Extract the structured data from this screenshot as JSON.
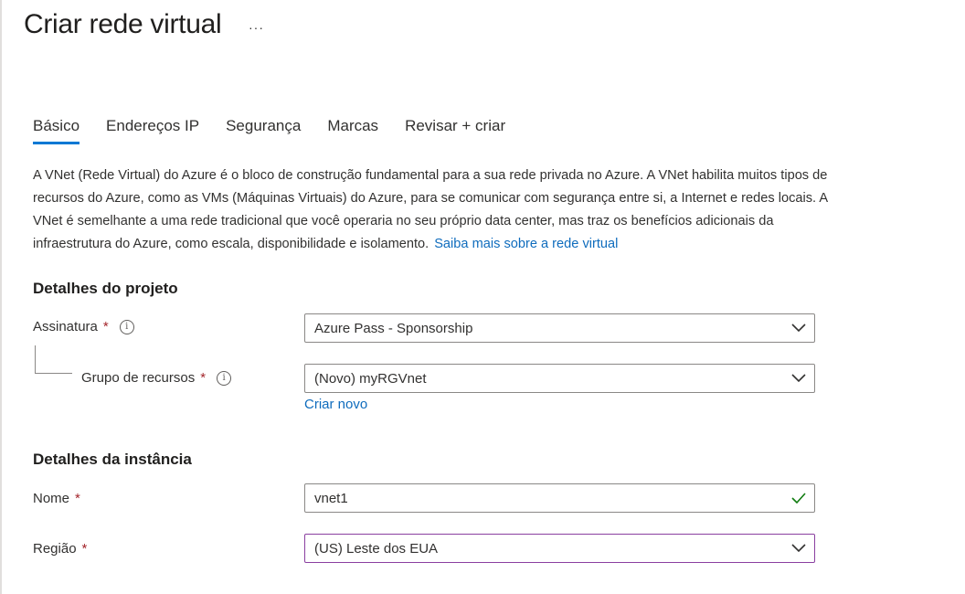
{
  "header": {
    "title": "Criar rede virtual",
    "more_label": "···"
  },
  "tabs": [
    {
      "label": "Básico",
      "active": true
    },
    {
      "label": "Endereços IP",
      "active": false
    },
    {
      "label": "Segurança",
      "active": false
    },
    {
      "label": "Marcas",
      "active": false
    },
    {
      "label": "Revisar + criar",
      "active": false
    }
  ],
  "intro": {
    "text": "A VNet (Rede Virtual) do Azure é o bloco de construção fundamental para a sua rede privada no Azure. A VNet habilita muitos tipos de recursos do Azure, como as VMs (Máquinas Virtuais) do Azure, para se comunicar com segurança entre si, a Internet e redes locais. A VNet é semelhante a uma rede tradicional que você operaria no seu próprio data center, mas traz os benefícios adicionais da infraestrutura do Azure, como escala, disponibilidade e isolamento.",
    "link": "Saiba mais sobre a rede virtual"
  },
  "project": {
    "heading": "Detalhes do projeto",
    "subscription_label": "Assinatura",
    "subscription_value": "Azure Pass - Sponsorship",
    "rg_label": "Grupo de recursos",
    "rg_value": "(Novo) myRGVnet",
    "create_new": "Criar novo"
  },
  "instance": {
    "heading": "Detalhes da instância",
    "name_label": "Nome",
    "name_value": "vnet1",
    "region_label": "Região",
    "region_value": "(US) Leste dos EUA"
  },
  "common": {
    "required_mark": "*",
    "info_glyph": "i"
  },
  "colors": {
    "accent": "#0078d4",
    "link": "#0f6cbd",
    "success": "#107c10",
    "required": "#a4262c",
    "focus": "#8a3fa0"
  }
}
